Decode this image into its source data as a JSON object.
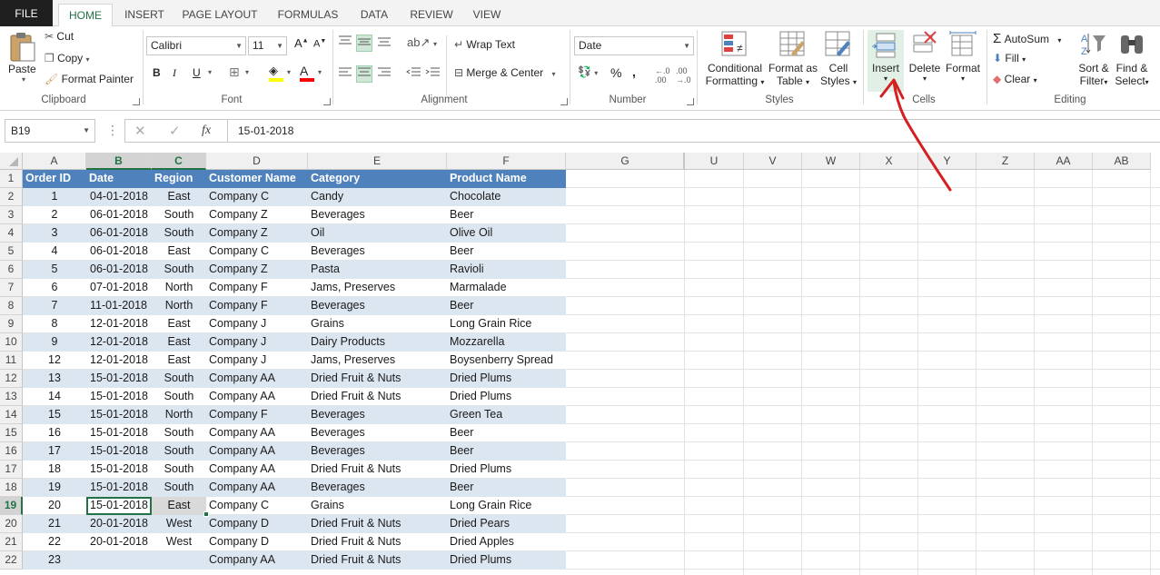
{
  "tabs": [
    "FILE",
    "HOME",
    "INSERT",
    "PAGE LAYOUT",
    "FORMULAS",
    "DATA",
    "REVIEW",
    "VIEW"
  ],
  "active_tab": "HOME",
  "clipboard": {
    "paste": "Paste",
    "cut": "Cut",
    "copy": "Copy",
    "format_painter": "Format Painter",
    "label": "Clipboard"
  },
  "font": {
    "name": "Calibri",
    "size": "11",
    "bold": "B",
    "italic": "I",
    "underline": "U",
    "label": "Font"
  },
  "alignment": {
    "wrap_text": "Wrap Text",
    "merge_center": "Merge & Center",
    "label": "Alignment"
  },
  "number": {
    "format": "Date",
    "percent": "%",
    "comma": ",",
    "label": "Number"
  },
  "styles": {
    "conditional": "Conditional",
    "formatting": "Formatting",
    "format_as": "Format as",
    "table": "Table",
    "cell": "Cell",
    "cell_styles": "Styles",
    "label": "Styles"
  },
  "cells": {
    "insert": "Insert",
    "delete": "Delete",
    "format": "Format",
    "label": "Cells"
  },
  "editing": {
    "autosum": "AutoSum",
    "fill": "Fill",
    "clear": "Clear",
    "sort": "Sort &",
    "filter": "Filter",
    "find": "Find &",
    "select": "Select",
    "label": "Editing"
  },
  "name_box": "B19",
  "formula_value": "15-01-2018",
  "fx": "fx",
  "columns": [
    "A",
    "B",
    "C",
    "D",
    "E",
    "F",
    "G",
    "U",
    "V",
    "W",
    "X",
    "Y",
    "Z",
    "AA",
    "AB"
  ],
  "header_row": [
    "Order ID",
    "Date",
    "Region",
    "Customer Name",
    "Category",
    "Product Name"
  ],
  "rows": [
    [
      "1",
      "04-01-2018",
      "East",
      "Company C",
      "Candy",
      "Chocolate"
    ],
    [
      "2",
      "06-01-2018",
      "South",
      "Company Z",
      "Beverages",
      "Beer"
    ],
    [
      "3",
      "06-01-2018",
      "South",
      "Company Z",
      "Oil",
      "Olive Oil"
    ],
    [
      "4",
      "06-01-2018",
      "East",
      "Company C",
      "Beverages",
      "Beer"
    ],
    [
      "5",
      "06-01-2018",
      "South",
      "Company Z",
      "Pasta",
      "Ravioli"
    ],
    [
      "6",
      "07-01-2018",
      "North",
      "Company F",
      "Jams, Preserves",
      "Marmalade"
    ],
    [
      "7",
      "11-01-2018",
      "North",
      "Company F",
      "Beverages",
      "Beer"
    ],
    [
      "8",
      "12-01-2018",
      "East",
      "Company J",
      "Grains",
      "Long Grain Rice"
    ],
    [
      "9",
      "12-01-2018",
      "East",
      "Company J",
      "Dairy Products",
      "Mozzarella"
    ],
    [
      "12",
      "12-01-2018",
      "East",
      "Company J",
      "Jams, Preserves",
      "Boysenberry Spread"
    ],
    [
      "13",
      "15-01-2018",
      "South",
      "Company AA",
      "Dried Fruit & Nuts",
      "Dried Plums"
    ],
    [
      "14",
      "15-01-2018",
      "South",
      "Company AA",
      "Dried Fruit & Nuts",
      "Dried Plums"
    ],
    [
      "15",
      "15-01-2018",
      "North",
      "Company F",
      "Beverages",
      "Green Tea"
    ],
    [
      "16",
      "15-01-2018",
      "South",
      "Company AA",
      "Beverages",
      "Beer"
    ],
    [
      "17",
      "15-01-2018",
      "South",
      "Company AA",
      "Beverages",
      "Beer"
    ],
    [
      "18",
      "15-01-2018",
      "South",
      "Company AA",
      "Dried Fruit & Nuts",
      "Dried Plums"
    ],
    [
      "19",
      "15-01-2018",
      "South",
      "Company AA",
      "Beverages",
      "Beer"
    ],
    [
      "20",
      "15-01-2018",
      "East",
      "Company C",
      "Grains",
      "Long Grain Rice"
    ],
    [
      "21",
      "20-01-2018",
      "West",
      "Company D",
      "Dried Fruit & Nuts",
      "Dried Pears"
    ],
    [
      "22",
      "20-01-2018",
      "West",
      "Company D",
      "Dried Fruit & Nuts",
      "Dried Apples"
    ],
    [
      "23",
      "",
      "",
      "Company AA",
      "Dried Fruit & Nuts",
      "Dried Plums"
    ]
  ],
  "row_numbers": [
    "1",
    "2",
    "3",
    "4",
    "5",
    "6",
    "7",
    "8",
    "9",
    "10",
    "11",
    "12",
    "13",
    "14",
    "15",
    "16",
    "17",
    "18",
    "19",
    "20",
    "21",
    "22"
  ],
  "selected_row": "19",
  "selected_cols": [
    "B",
    "C"
  ],
  "colors": {
    "excel_green": "#217346",
    "header_fill": "#4f81bd",
    "band_fill": "#dce6f1",
    "annotation": "#d42020"
  }
}
